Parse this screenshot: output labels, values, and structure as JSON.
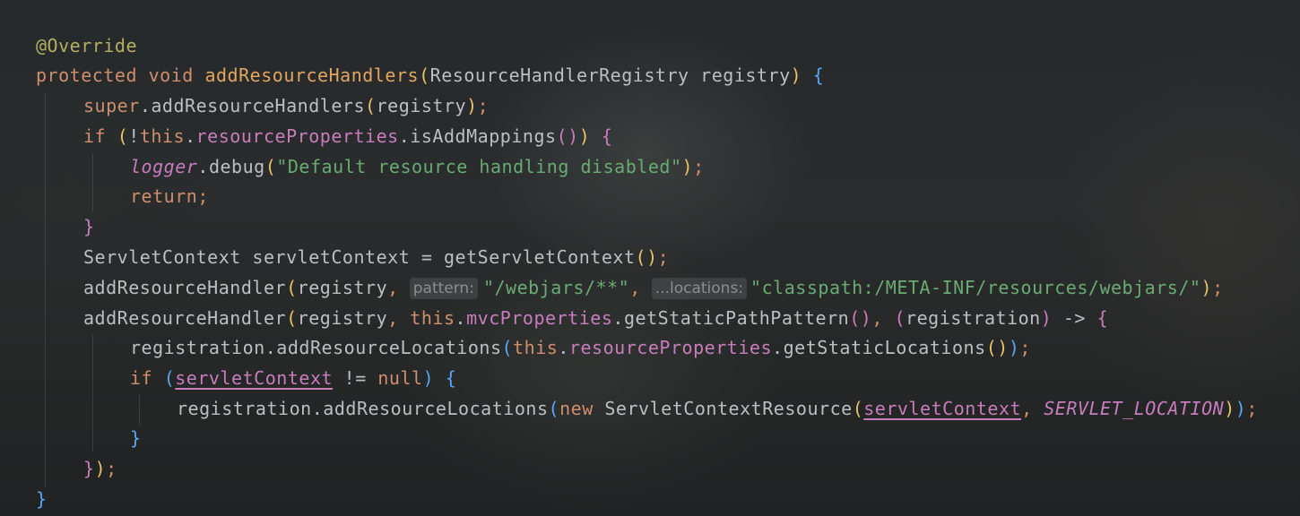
{
  "editor": {
    "language": "java",
    "code": {
      "override_annotation": "@Override",
      "kw_protected": "protected",
      "kw_void": "void",
      "method_name": "addResourceHandlers",
      "param_type": "ResourceHandlerRegistry",
      "param_name": "registry",
      "kw_super": "super",
      "call_add_resource_handlers": "addResourceHandlers",
      "arg_registry": "registry",
      "kw_if": "if",
      "kw_this": "this",
      "field_resource_properties": "resourceProperties",
      "call_is_add_mappings": "isAddMappings",
      "logger_field": "logger",
      "call_debug": "debug",
      "debug_message": "\"Default resource handling disabled\"",
      "kw_return": "return",
      "servlet_context_type": "ServletContext",
      "servlet_context_var": "servletContext",
      "call_get_servlet_context": "getServletContext",
      "call_add_resource_handler": "addResourceHandler",
      "hint_pattern": "pattern:",
      "webjars_pattern": "\"/webjars/**\"",
      "hint_locations": "...locations:",
      "webjars_location": "\"classpath:/META-INF/resources/webjars/\"",
      "field_mvc_properties": "mvcProperties",
      "call_get_static_path_pattern": "getStaticPathPattern",
      "lambda_param": "registration",
      "call_add_resource_locations": "addResourceLocations",
      "call_get_static_locations": "getStaticLocations",
      "kw_null": "null",
      "kw_new": "new",
      "servlet_context_resource_type": "ServletContextResource",
      "servlet_location_const": "SERVLET_LOCATION"
    }
  },
  "colors": {
    "background": "#232629",
    "keyword": "#cf8e6d",
    "annotation": "#b3ae60",
    "method_declaration": "#e2a65d",
    "field": "#c77dbb",
    "string": "#6aab73",
    "default_text": "#bcbec4",
    "bracket_level_1": "#e8c26a",
    "bracket_level_2": "#c77dbb",
    "bracket_level_3": "#56a8f5",
    "inlay_hint": "#8a8d91"
  }
}
